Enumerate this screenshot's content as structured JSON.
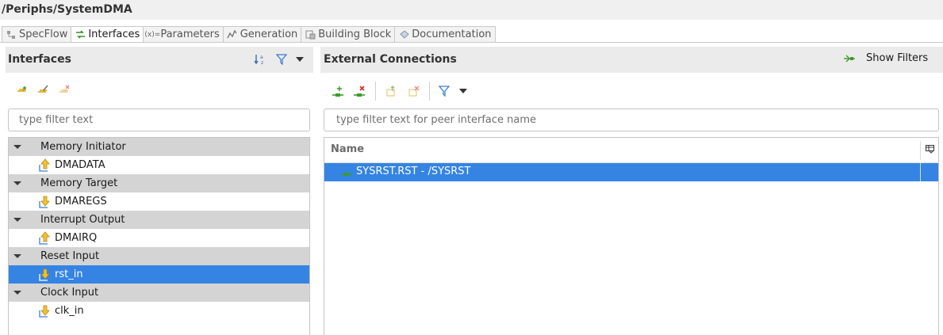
{
  "window": {
    "path": "/Periphs/SystemDMA"
  },
  "tabs": [
    {
      "label": "SpecFlow",
      "icon": "specflow-icon",
      "active": false
    },
    {
      "label": "Interfaces",
      "icon": "interfaces-icon",
      "active": true
    },
    {
      "label": "Parameters",
      "icon": "parameters-icon",
      "active": false
    },
    {
      "label": "Generation",
      "icon": "generation-icon",
      "active": false
    },
    {
      "label": "Building Block",
      "icon": "building-block-icon",
      "active": false
    },
    {
      "label": "Documentation",
      "icon": "documentation-icon",
      "active": false
    }
  ],
  "left_panel": {
    "title": "Interfaces",
    "filter_placeholder": "type filter text",
    "tree": [
      {
        "group": "Memory Initiator",
        "items": [
          {
            "label": "DMADATA",
            "direction": "up",
            "selected": false
          }
        ]
      },
      {
        "group": "Memory Target",
        "items": [
          {
            "label": "DMAREGS",
            "direction": "down",
            "selected": false
          }
        ]
      },
      {
        "group": "Interrupt Output",
        "items": [
          {
            "label": "DMAIRQ",
            "direction": "up",
            "selected": false
          }
        ]
      },
      {
        "group": "Reset Input",
        "items": [
          {
            "label": "rst_in",
            "direction": "down",
            "selected": true
          }
        ]
      },
      {
        "group": "Clock Input",
        "items": [
          {
            "label": "clk_in",
            "direction": "down",
            "selected": false
          }
        ]
      }
    ]
  },
  "right_panel": {
    "title": "External Connections",
    "show_filters_label": "Show Filters",
    "filter_placeholder": "type filter text for peer interface name",
    "table": {
      "column_name": "Name",
      "rows": [
        {
          "label": "SYSRST.RST - /SYSRST",
          "selected": true
        }
      ]
    }
  },
  "colors": {
    "selection": "#3584e4",
    "group_row": "#d4d4d4",
    "panel_header": "#ebebeb"
  }
}
